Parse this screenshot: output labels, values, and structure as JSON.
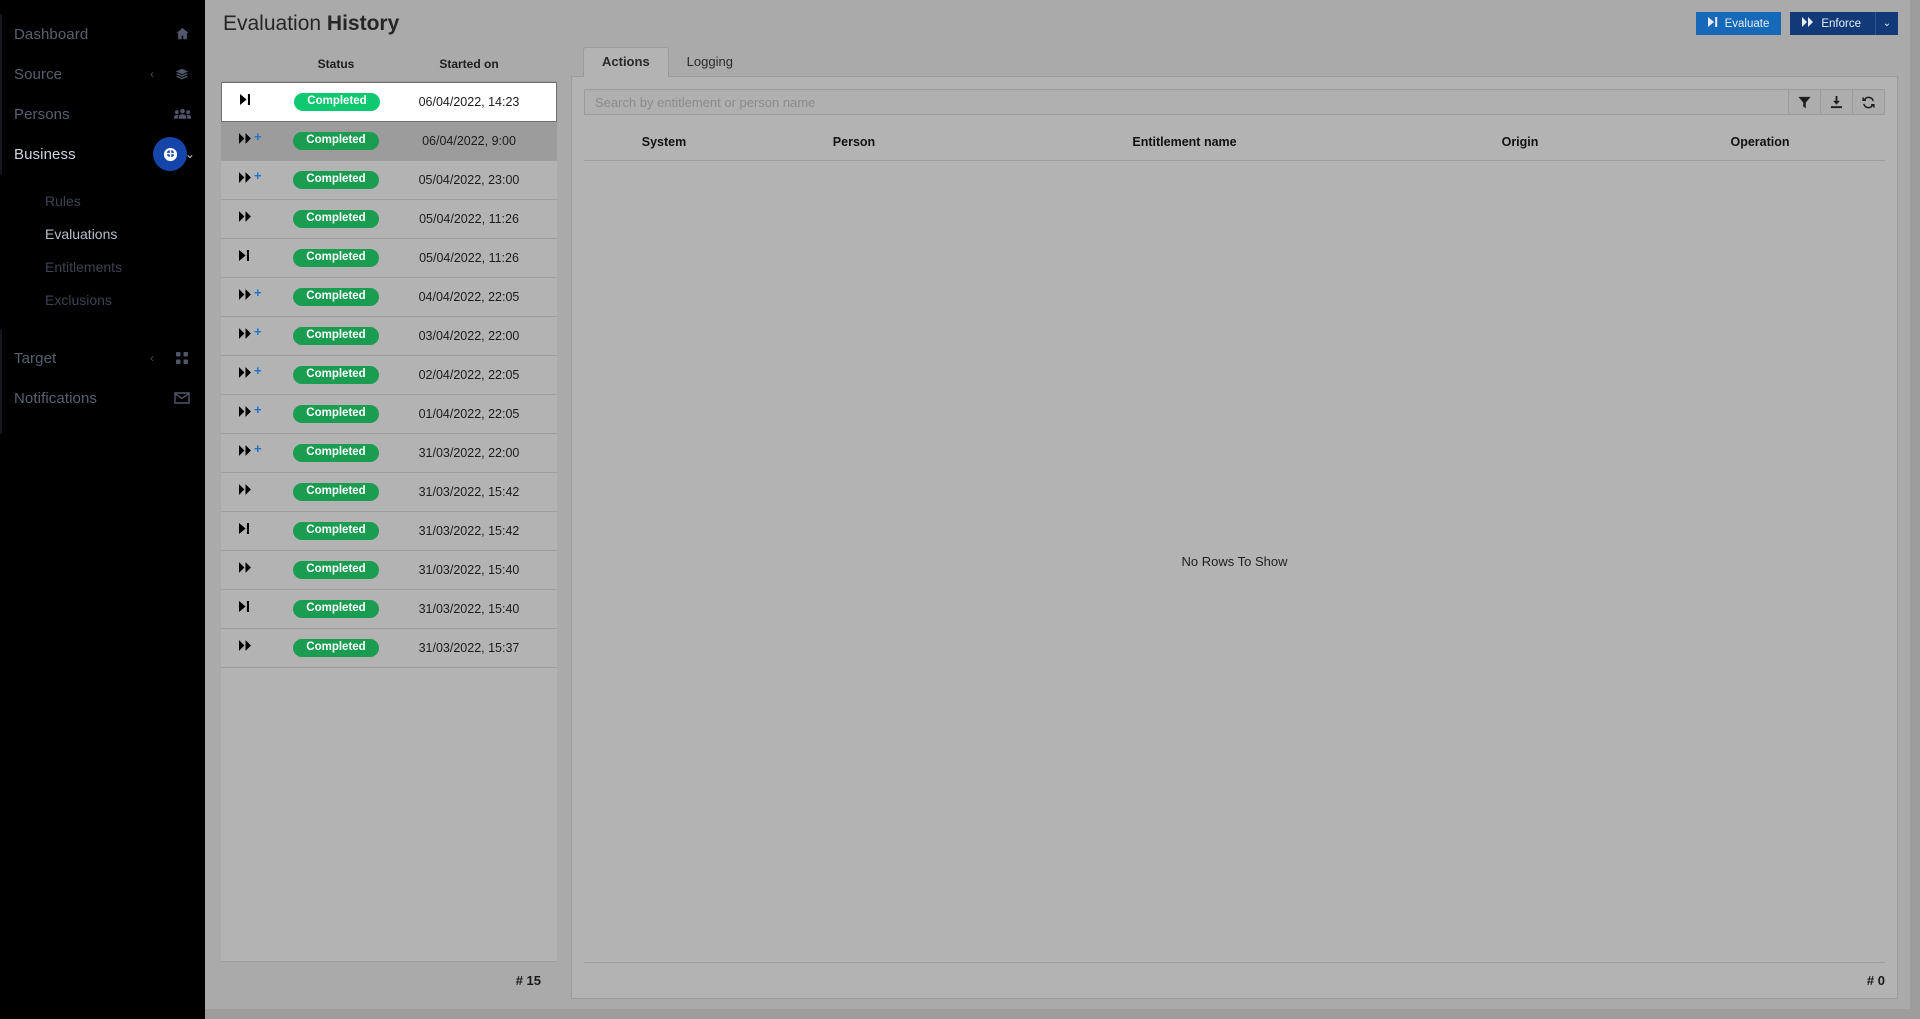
{
  "sidebar": {
    "items": [
      {
        "label": "Dashboard",
        "icon": "home-icon",
        "active": false,
        "chevron": ""
      },
      {
        "label": "Source",
        "icon": "layers-icon",
        "active": false,
        "chevron": "‹"
      },
      {
        "label": "Persons",
        "icon": "people-icon",
        "active": false,
        "chevron": ""
      },
      {
        "label": "Business",
        "icon": "briefcase-icon",
        "active": true,
        "chevron": "⌄"
      },
      {
        "label": "Target",
        "icon": "grid-icon",
        "active": false,
        "chevron": "‹"
      },
      {
        "label": "Notifications",
        "icon": "envelope-icon",
        "active": false,
        "chevron": ""
      }
    ],
    "subitems": [
      {
        "label": "Rules",
        "active": false
      },
      {
        "label": "Evaluations",
        "active": true
      },
      {
        "label": "Entitlements",
        "active": false
      },
      {
        "label": "Exclusions",
        "active": false
      }
    ]
  },
  "header": {
    "title_normal": "Evaluation ",
    "title_bold": "History",
    "evaluate_label": "Evaluate",
    "enforce_label": "Enforce",
    "caret": "⌄"
  },
  "history": {
    "columns": {
      "status": "Status",
      "started": "Started on"
    },
    "count_label": "# 15",
    "rows": [
      {
        "icon": "skip-end-icon",
        "extra": "",
        "status": "Completed",
        "started": "06/04/2022, 14:23",
        "selected": true,
        "hovered": false
      },
      {
        "icon": "fast-forward-icon",
        "extra": "+",
        "status": "Completed",
        "started": "06/04/2022, 9:00",
        "selected": false,
        "hovered": true
      },
      {
        "icon": "fast-forward-icon",
        "extra": "+",
        "status": "Completed",
        "started": "05/04/2022, 23:00",
        "selected": false,
        "hovered": false
      },
      {
        "icon": "fast-forward-icon",
        "extra": "",
        "status": "Completed",
        "started": "05/04/2022, 11:26",
        "selected": false,
        "hovered": false
      },
      {
        "icon": "skip-end-icon",
        "extra": "",
        "status": "Completed",
        "started": "05/04/2022, 11:26",
        "selected": false,
        "hovered": false
      },
      {
        "icon": "fast-forward-icon",
        "extra": "+",
        "status": "Completed",
        "started": "04/04/2022, 22:05",
        "selected": false,
        "hovered": false
      },
      {
        "icon": "fast-forward-icon",
        "extra": "+",
        "status": "Completed",
        "started": "03/04/2022, 22:00",
        "selected": false,
        "hovered": false
      },
      {
        "icon": "fast-forward-icon",
        "extra": "+",
        "status": "Completed",
        "started": "02/04/2022, 22:05",
        "selected": false,
        "hovered": false
      },
      {
        "icon": "fast-forward-icon",
        "extra": "+",
        "status": "Completed",
        "started": "01/04/2022, 22:05",
        "selected": false,
        "hovered": false
      },
      {
        "icon": "fast-forward-icon",
        "extra": "+",
        "status": "Completed",
        "started": "31/03/2022, 22:00",
        "selected": false,
        "hovered": false
      },
      {
        "icon": "fast-forward-icon",
        "extra": "",
        "status": "Completed",
        "started": "31/03/2022, 15:42",
        "selected": false,
        "hovered": false
      },
      {
        "icon": "skip-end-icon",
        "extra": "",
        "status": "Completed",
        "started": "31/03/2022, 15:42",
        "selected": false,
        "hovered": false
      },
      {
        "icon": "fast-forward-icon",
        "extra": "",
        "status": "Completed",
        "started": "31/03/2022, 15:40",
        "selected": false,
        "hovered": false
      },
      {
        "icon": "skip-end-icon",
        "extra": "",
        "status": "Completed",
        "started": "31/03/2022, 15:40",
        "selected": false,
        "hovered": false
      },
      {
        "icon": "fast-forward-icon",
        "extra": "",
        "status": "Completed",
        "started": "31/03/2022, 15:37",
        "selected": false,
        "hovered": false
      }
    ]
  },
  "detail": {
    "tabs": [
      {
        "label": "Actions",
        "active": true
      },
      {
        "label": "Logging",
        "active": false
      }
    ],
    "search_placeholder": "Search by entitlement or person name",
    "search_value": "",
    "toolbar": [
      {
        "name": "filter-icon",
        "title": "Filter"
      },
      {
        "name": "download-icon",
        "title": "Download"
      },
      {
        "name": "refresh-icon",
        "title": "Refresh"
      }
    ],
    "grid_columns": [
      "System",
      "Person",
      "Entitlement name",
      "Origin",
      "Operation"
    ],
    "empty_text": "No Rows To Show",
    "count_label": "# 0"
  },
  "colors": {
    "sidebar_bg": "#000000",
    "page_bg": "#aaaaaa",
    "accent_blue": "#1668b8",
    "dark_blue": "#123a78",
    "badge_blue": "#1545a8",
    "status_green": "#1a9c51",
    "status_green_bright": "#0ec96f"
  }
}
